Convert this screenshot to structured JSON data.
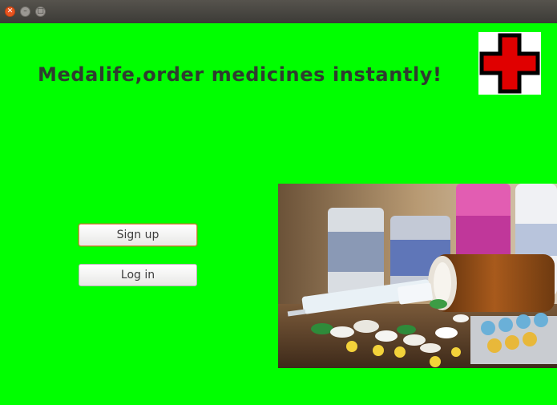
{
  "window": {
    "controls": {
      "close_glyph": "✕",
      "minimize_glyph": "–",
      "maximize_glyph": "□"
    }
  },
  "main": {
    "heading": "Medalife,order medicines instantly!",
    "background_color": "#00ff00",
    "logo_icon": "red-cross-icon",
    "photo_icon": "medicine-photo"
  },
  "actions": {
    "signup_label": "Sign up",
    "login_label": "Log in"
  }
}
